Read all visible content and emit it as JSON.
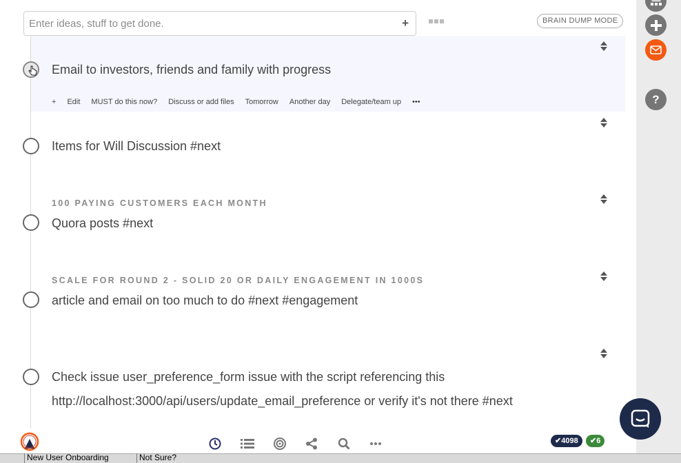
{
  "input": {
    "placeholder": "Enter ideas, stuff to get done.",
    "add_label": "+"
  },
  "brain_dump_label": "BRAIN DUMP MODE",
  "tasks": [
    {
      "text": "Email to investors, friends and family with progress",
      "section": ""
    },
    {
      "text": "Items for Will Discussion #next",
      "section": ""
    },
    {
      "text": "Quora posts #next",
      "section": "100 PAYING CUSTOMERS EACH MONTH"
    },
    {
      "text": "article and email on too much to do #next #engagement",
      "section": "SCALE FOR ROUND 2 - SOLID 20 OR DAILY ENGAGEMENT IN 1000S"
    },
    {
      "text": "Check issue user_preference_form issue with the script referencing this",
      "text2": "http://localhost:3000/api/users/update_email_preference or verify it's not there #next",
      "section": ""
    }
  ],
  "actions": [
    "+",
    "Edit",
    "MUST do this now?",
    "Discuss or add files",
    "Tomorrow",
    "Another day",
    "Delegate/team up",
    "•••"
  ],
  "badges": {
    "total": "✔4098",
    "today": "✔6"
  },
  "taskbar": [
    "New User Onboarding",
    "Not Sure?"
  ],
  "colors": {
    "accent_orange": "#f25a13",
    "badge_dark": "#1e2a4a",
    "badge_green": "#3c8a3c",
    "sidebar": "#ebebeb"
  }
}
